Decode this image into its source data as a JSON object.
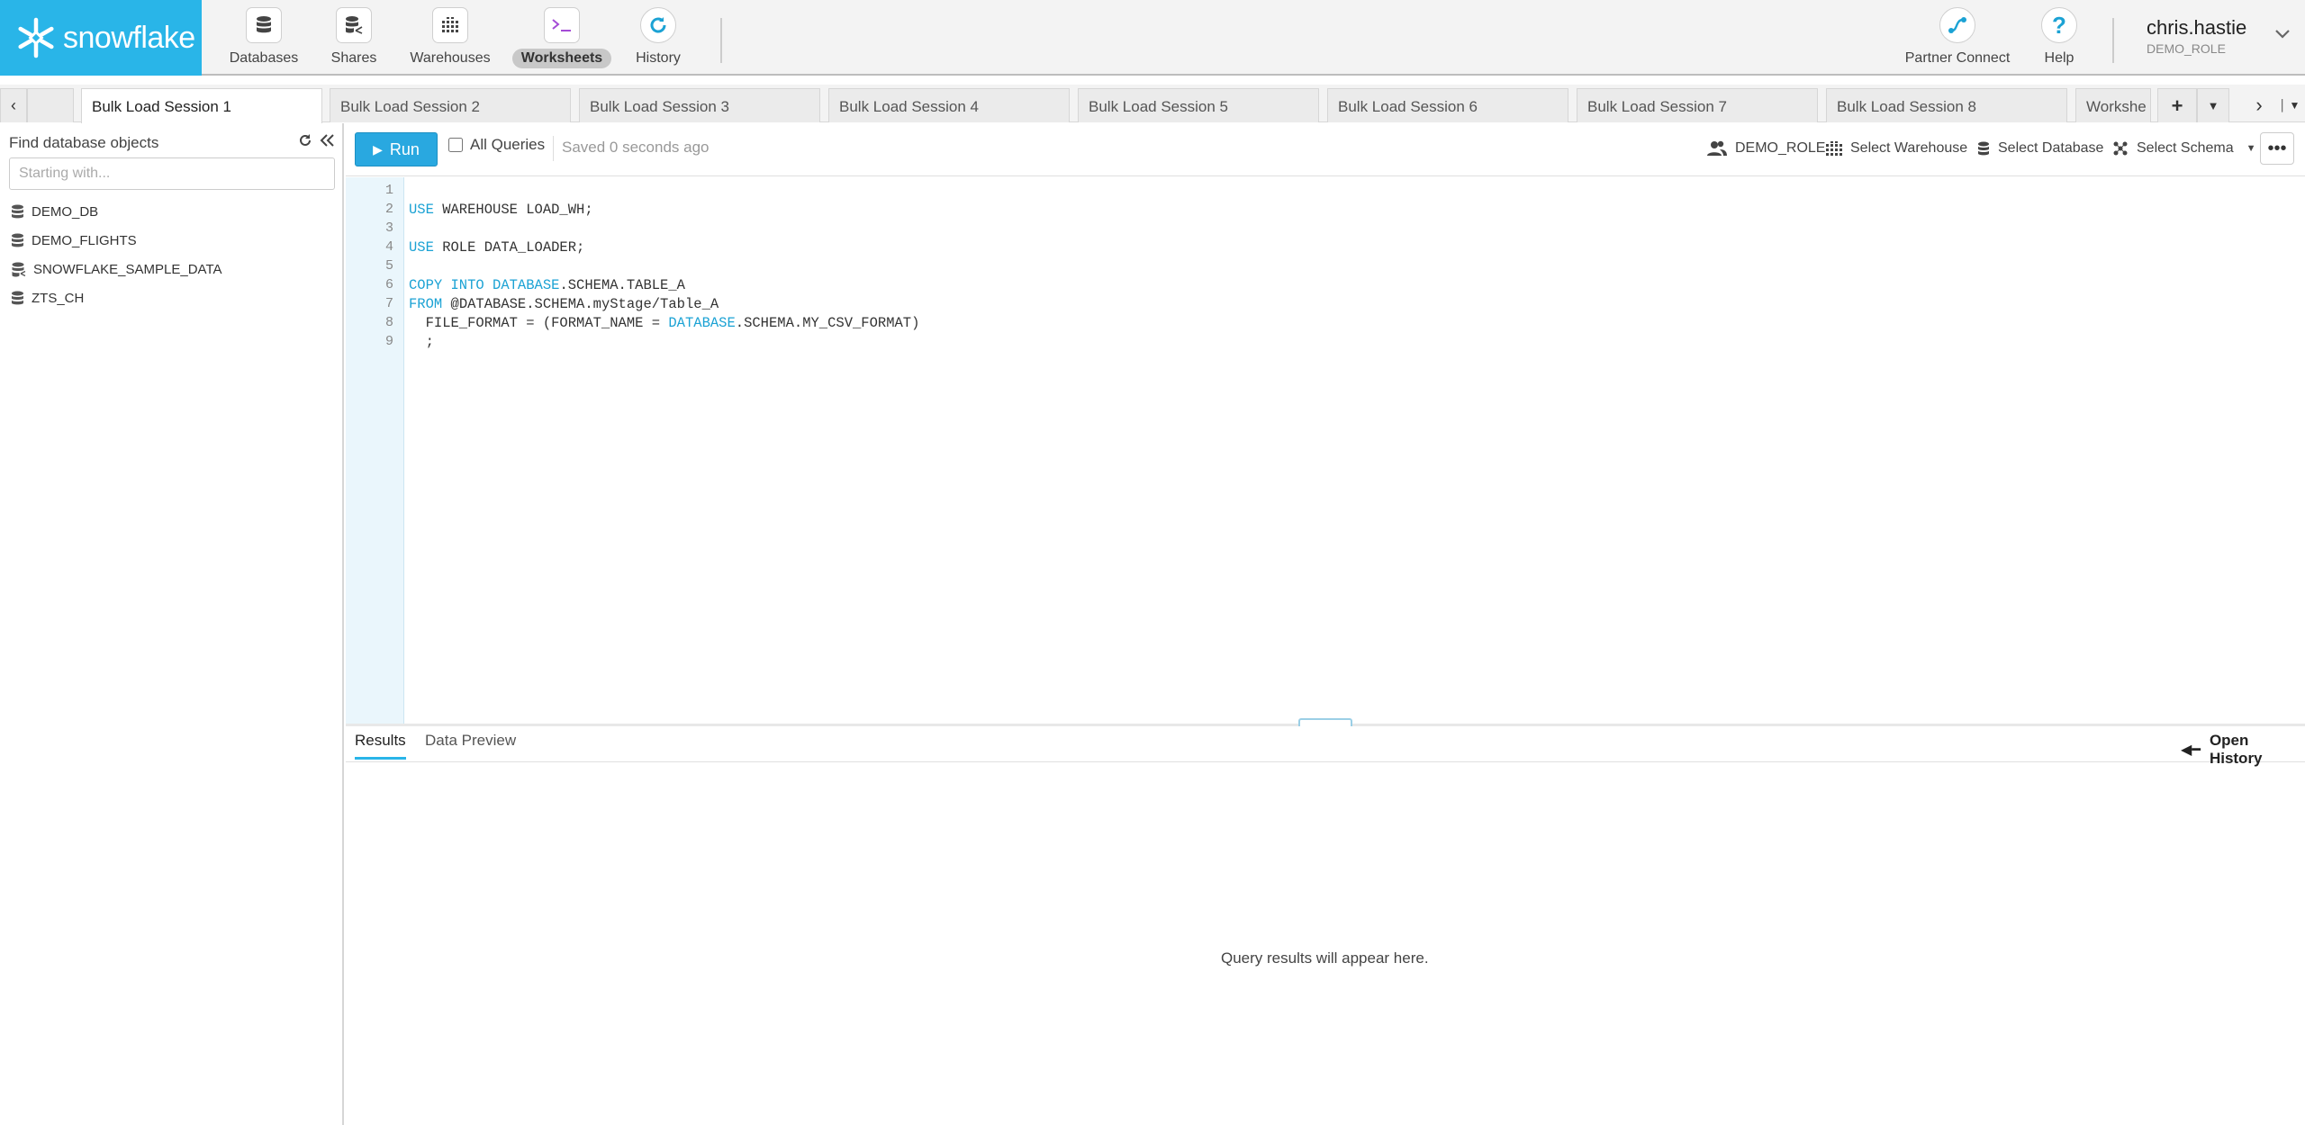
{
  "app": {
    "logo_text": "snowflake"
  },
  "nav": {
    "items": [
      {
        "label": "Databases",
        "icon": "database-icon"
      },
      {
        "label": "Shares",
        "icon": "share-icon"
      },
      {
        "label": "Warehouses",
        "icon": "warehouse-icon"
      },
      {
        "label": "Worksheets",
        "icon": "terminal-icon",
        "active": true
      },
      {
        "label": "History",
        "icon": "history-icon"
      }
    ],
    "partner_connect": "Partner Connect",
    "help": "Help",
    "user": {
      "name": "chris.hastie",
      "role": "DEMO_ROLE"
    }
  },
  "worksheet_tabs": [
    "Bulk Load Session 1",
    "Bulk Load Session 2",
    "Bulk Load Session 3",
    "Bulk Load Session 4",
    "Bulk Load Session 5",
    "Bulk Load Session 6",
    "Bulk Load Session 7",
    "Bulk Load Session 8",
    "Workshe"
  ],
  "sidebar": {
    "title": "Find database objects",
    "search_placeholder": "Starting with...",
    "databases": [
      "DEMO_DB",
      "DEMO_FLIGHTS",
      "SNOWFLAKE_SAMPLE_DATA",
      "ZTS_CH"
    ]
  },
  "toolbar": {
    "run_label": "Run",
    "all_queries_label": "All Queries",
    "saved_status": "Saved 0 seconds ago",
    "role": "DEMO_ROLE",
    "warehouse": "Select Warehouse",
    "database": "Select Database",
    "schema": "Select Schema"
  },
  "editor": {
    "line_numbers": [
      "1",
      "2",
      "3",
      "4",
      "5",
      "6",
      "7",
      "8",
      "9"
    ],
    "lines": [
      {
        "kw1": "",
        "t1": "",
        "kw2": "",
        "t2": ""
      },
      {
        "kw1": "USE",
        "t1": " WAREHOUSE LOAD_WH;",
        "kw2": "",
        "t2": ""
      },
      {
        "kw1": "",
        "t1": "",
        "kw2": "",
        "t2": ""
      },
      {
        "kw1": "USE",
        "t1": " ROLE DATA_LOADER;",
        "kw2": "",
        "t2": ""
      },
      {
        "kw1": "",
        "t1": "",
        "kw2": "",
        "t2": ""
      },
      {
        "kw1": "COPY INTO DATABASE",
        "t1": ".SCHEMA.TABLE_A",
        "kw2": "",
        "t2": ""
      },
      {
        "kw1": "FROM",
        "t1": " @DATABASE.SCHEMA.myStage/Table_A",
        "kw2": "",
        "t2": ""
      },
      {
        "kw1": "",
        "t1": "  FILE_FORMAT = (FORMAT_NAME = ",
        "kw2": "DATABASE",
        "t2": ".SCHEMA.MY_CSV_FORMAT)"
      },
      {
        "kw1": "",
        "t1": "  ;",
        "kw2": "",
        "t2": ""
      }
    ]
  },
  "results": {
    "tabs": [
      "Results",
      "Data Preview"
    ],
    "open_history": "Open History",
    "empty_message": "Query results will appear here."
  },
  "colors": {
    "brand": "#29b5e8",
    "run_button": "#29a8e0",
    "keyword": "#1ba2d4"
  }
}
